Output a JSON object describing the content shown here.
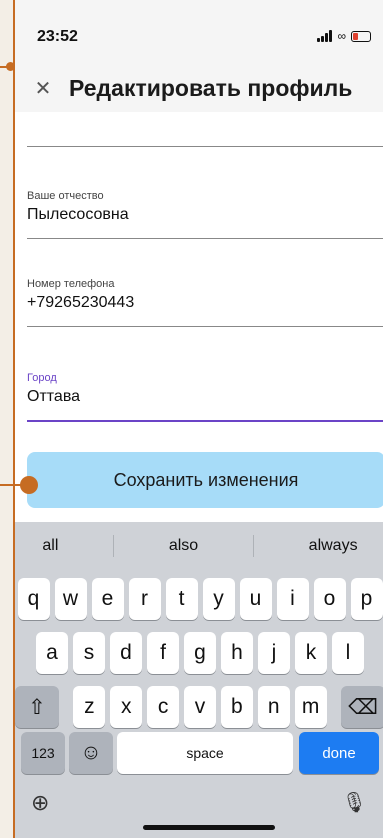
{
  "status_bar": {
    "time": "23:52"
  },
  "header": {
    "title": "Редактировать профиль",
    "close_icon": "close-icon"
  },
  "form": {
    "fields": [
      {
        "label": "Ваше отчество",
        "value": "Пылесосовна"
      },
      {
        "label": "Номер телефона",
        "value": "+79265230443"
      },
      {
        "label": "Город",
        "value": "Оттава",
        "active": true
      }
    ],
    "save_label": "Сохранить изменения"
  },
  "keyboard": {
    "suggestions": [
      "all",
      "also",
      "always"
    ],
    "row1": [
      "q",
      "w",
      "e",
      "r",
      "t",
      "y",
      "u",
      "i",
      "o",
      "p"
    ],
    "row2": [
      "a",
      "s",
      "d",
      "f",
      "g",
      "h",
      "j",
      "k",
      "l"
    ],
    "row3": [
      "z",
      "x",
      "c",
      "v",
      "b",
      "n",
      "m"
    ],
    "numbers_label": "123",
    "space_label": "space",
    "done_label": "done"
  },
  "colors": {
    "accent": "#6b44c7",
    "button_bg": "#a7dcf8",
    "done_key": "#1d7cf2",
    "annotation": "#c66c23"
  }
}
